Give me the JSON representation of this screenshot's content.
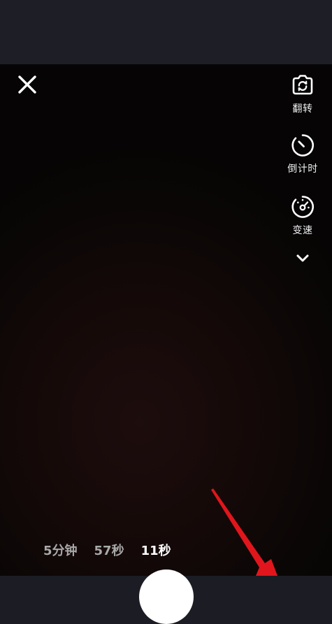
{
  "toolbar": {
    "flip_label": "翻转",
    "timer_label": "倒计时",
    "speed_label": "变速"
  },
  "duration_tabs": [
    {
      "label": "5分钟",
      "selected": false
    },
    {
      "label": "57秒",
      "selected": false
    },
    {
      "label": "11秒",
      "selected": true
    }
  ],
  "icons": {
    "close": "close-icon",
    "flip": "camera-flip-icon",
    "timer": "timer-icon",
    "speed": "speed-icon",
    "more": "chevron-down-icon"
  },
  "colors": {
    "top_bar": "#1d1e26",
    "viewfinder": "#140908",
    "tab_active": "#ffffff",
    "tab_inactive": "#a9a9a9",
    "annotation_arrow": "#e0161c"
  }
}
